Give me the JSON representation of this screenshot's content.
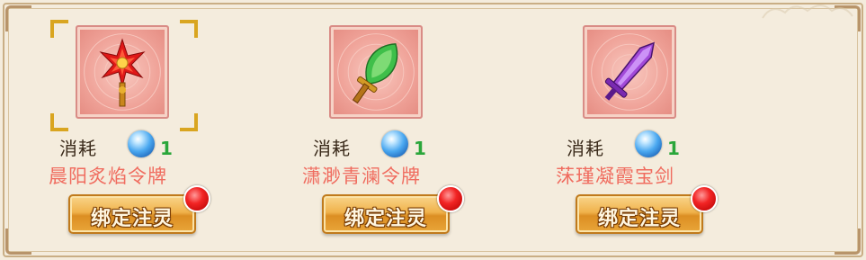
{
  "panel": {
    "cost_label": "消耗",
    "button_label": "绑定注灵"
  },
  "items": [
    {
      "name": "晨阳炙焰令牌",
      "cost_label": "消耗",
      "cost_count": "1",
      "button_label": "绑定注灵",
      "icon": "red-flame-token-icon",
      "selected": true,
      "has_notification": true
    },
    {
      "name": "潇渺青澜令牌",
      "cost_label": "消耗",
      "cost_count": "1",
      "button_label": "绑定注灵",
      "icon": "green-jade-token-icon",
      "selected": false,
      "has_notification": true
    },
    {
      "name": "莯瑾凝霞宝剑",
      "cost_label": "消耗",
      "cost_count": "1",
      "button_label": "绑定注灵",
      "icon": "purple-sword-icon",
      "selected": false,
      "has_notification": true
    }
  ],
  "colors": {
    "item_name": "#f06c5f",
    "cost_count": "#2aa63a",
    "button": "#f0b24b",
    "notification_dot": "#f22424",
    "selection_corner": "#d9a520"
  }
}
